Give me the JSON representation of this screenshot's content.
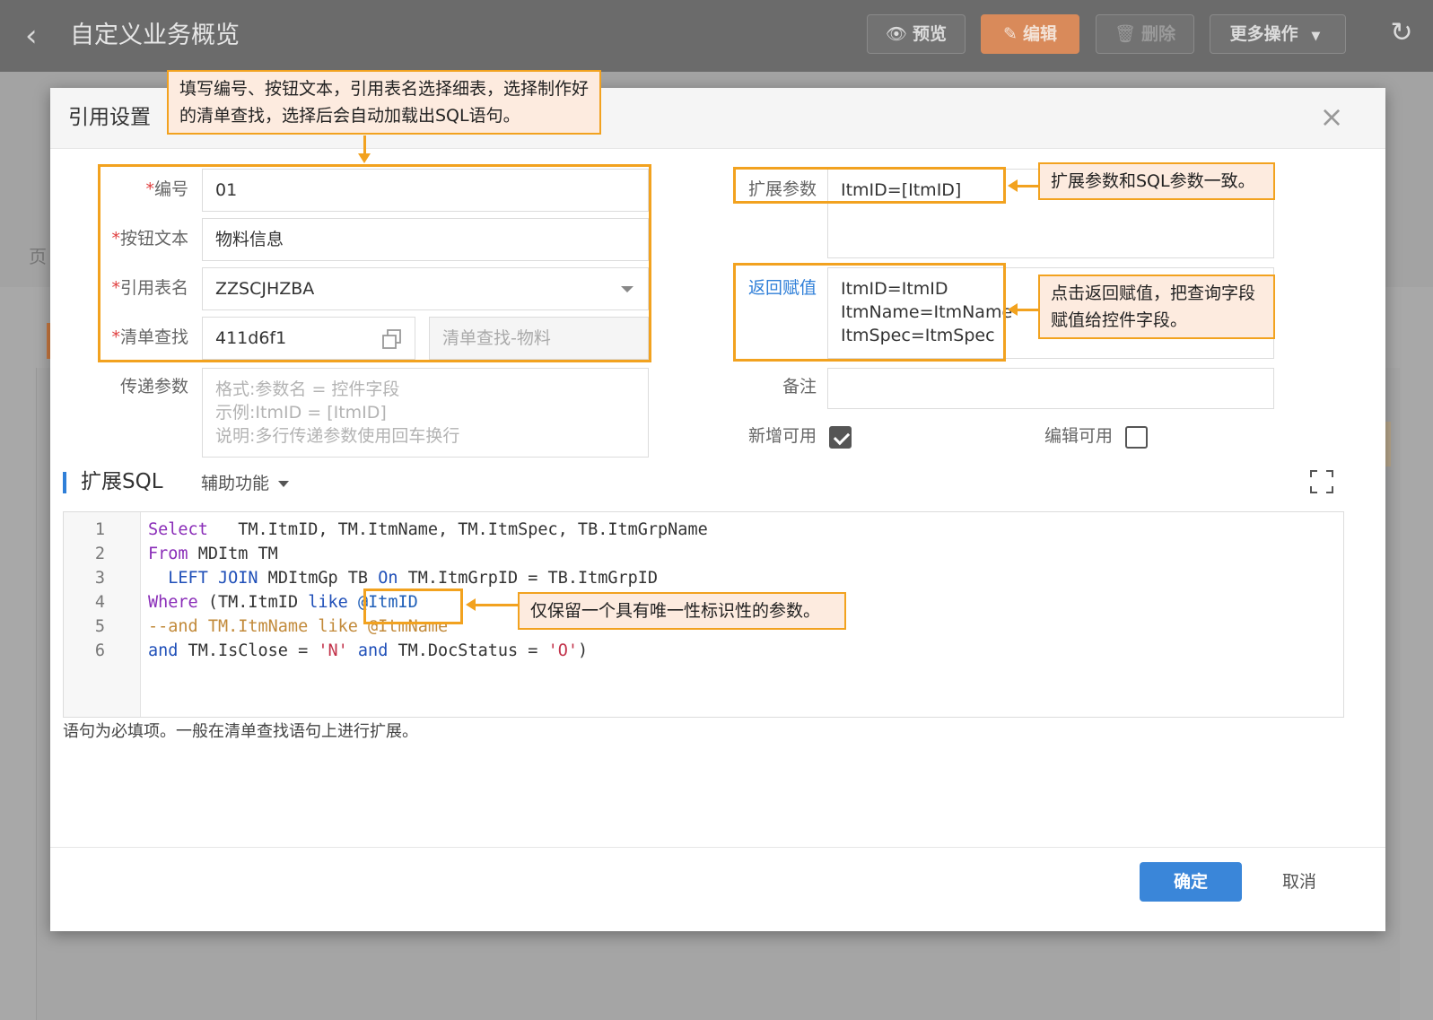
{
  "header": {
    "title": "自定义业务概览",
    "buttons": {
      "preview": "预览",
      "edit": "编辑",
      "delete": "删除",
      "more": "更多操作"
    }
  },
  "background": {
    "page_char": "页"
  },
  "modal": {
    "title": "引用设置",
    "fields": {
      "number": {
        "label": "编号",
        "value": "01"
      },
      "button_text": {
        "label": "按钮文本",
        "value": "物料信息"
      },
      "ref_table": {
        "label": "引用表名",
        "value": "ZZSCJHZBA"
      },
      "list_lookup": {
        "label": "清单查找",
        "value": "411d6f1",
        "name": "清单查找-物料"
      },
      "pass_params": {
        "label": "传递参数",
        "placeholder": "格式:参数名 = 控件字段\n示例:ItmID = [ItmID]\n说明:多行传递参数使用回车换行"
      },
      "ext_params": {
        "label": "扩展参数",
        "value": "ItmID=[ItmID]"
      },
      "return_assign": {
        "label": "返回赋值",
        "lines": [
          "ItmID=ItmID",
          "ItmName=ItmName",
          "ItmSpec=ItmSpec"
        ]
      },
      "remark": {
        "label": "备注",
        "value": ""
      },
      "add_enabled": {
        "label": "新增可用",
        "checked": true
      },
      "edit_enabled": {
        "label": "编辑可用",
        "checked": false
      }
    },
    "sql_section": {
      "title": "扩展SQL",
      "assist": "辅助功能",
      "line_numbers": [
        "1",
        "2",
        "3",
        "4",
        "5",
        "6"
      ],
      "lines": [
        "Select   TM.ItmID, TM.ItmName, TM.ItmSpec, TB.ItmGrpName",
        "From MDItm TM",
        "  LEFT JOIN MDItmGp TB On TM.ItmGrpID = TB.ItmGrpID",
        "Where (TM.ItmID like @ItmID",
        "--and TM.ItmName like @ItmName",
        "and TM.IsClose = 'N' and TM.DocStatus = 'O')"
      ],
      "hint": "语句为必填项。一般在清单查找语句上进行扩展。"
    },
    "footer": {
      "ok": "确定",
      "cancel": "取消"
    }
  },
  "annotations": {
    "top": "填写编号、按钮文本，引用表名选择细表，选择制作好的清单查找，选择后会自动加载出SQL语句。",
    "ext_params": "扩展参数和SQL参数一致。",
    "return_assign": "点击返回赋值，把查询字段赋值给控件字段。",
    "sql_param": "仅保留一个具有唯一性标识性的参数。"
  },
  "colors": {
    "accent": "#3a86d9",
    "annotation": "#f2a21f",
    "annotation_bg": "#fdebdf",
    "edit_button": "#d98a5a"
  }
}
